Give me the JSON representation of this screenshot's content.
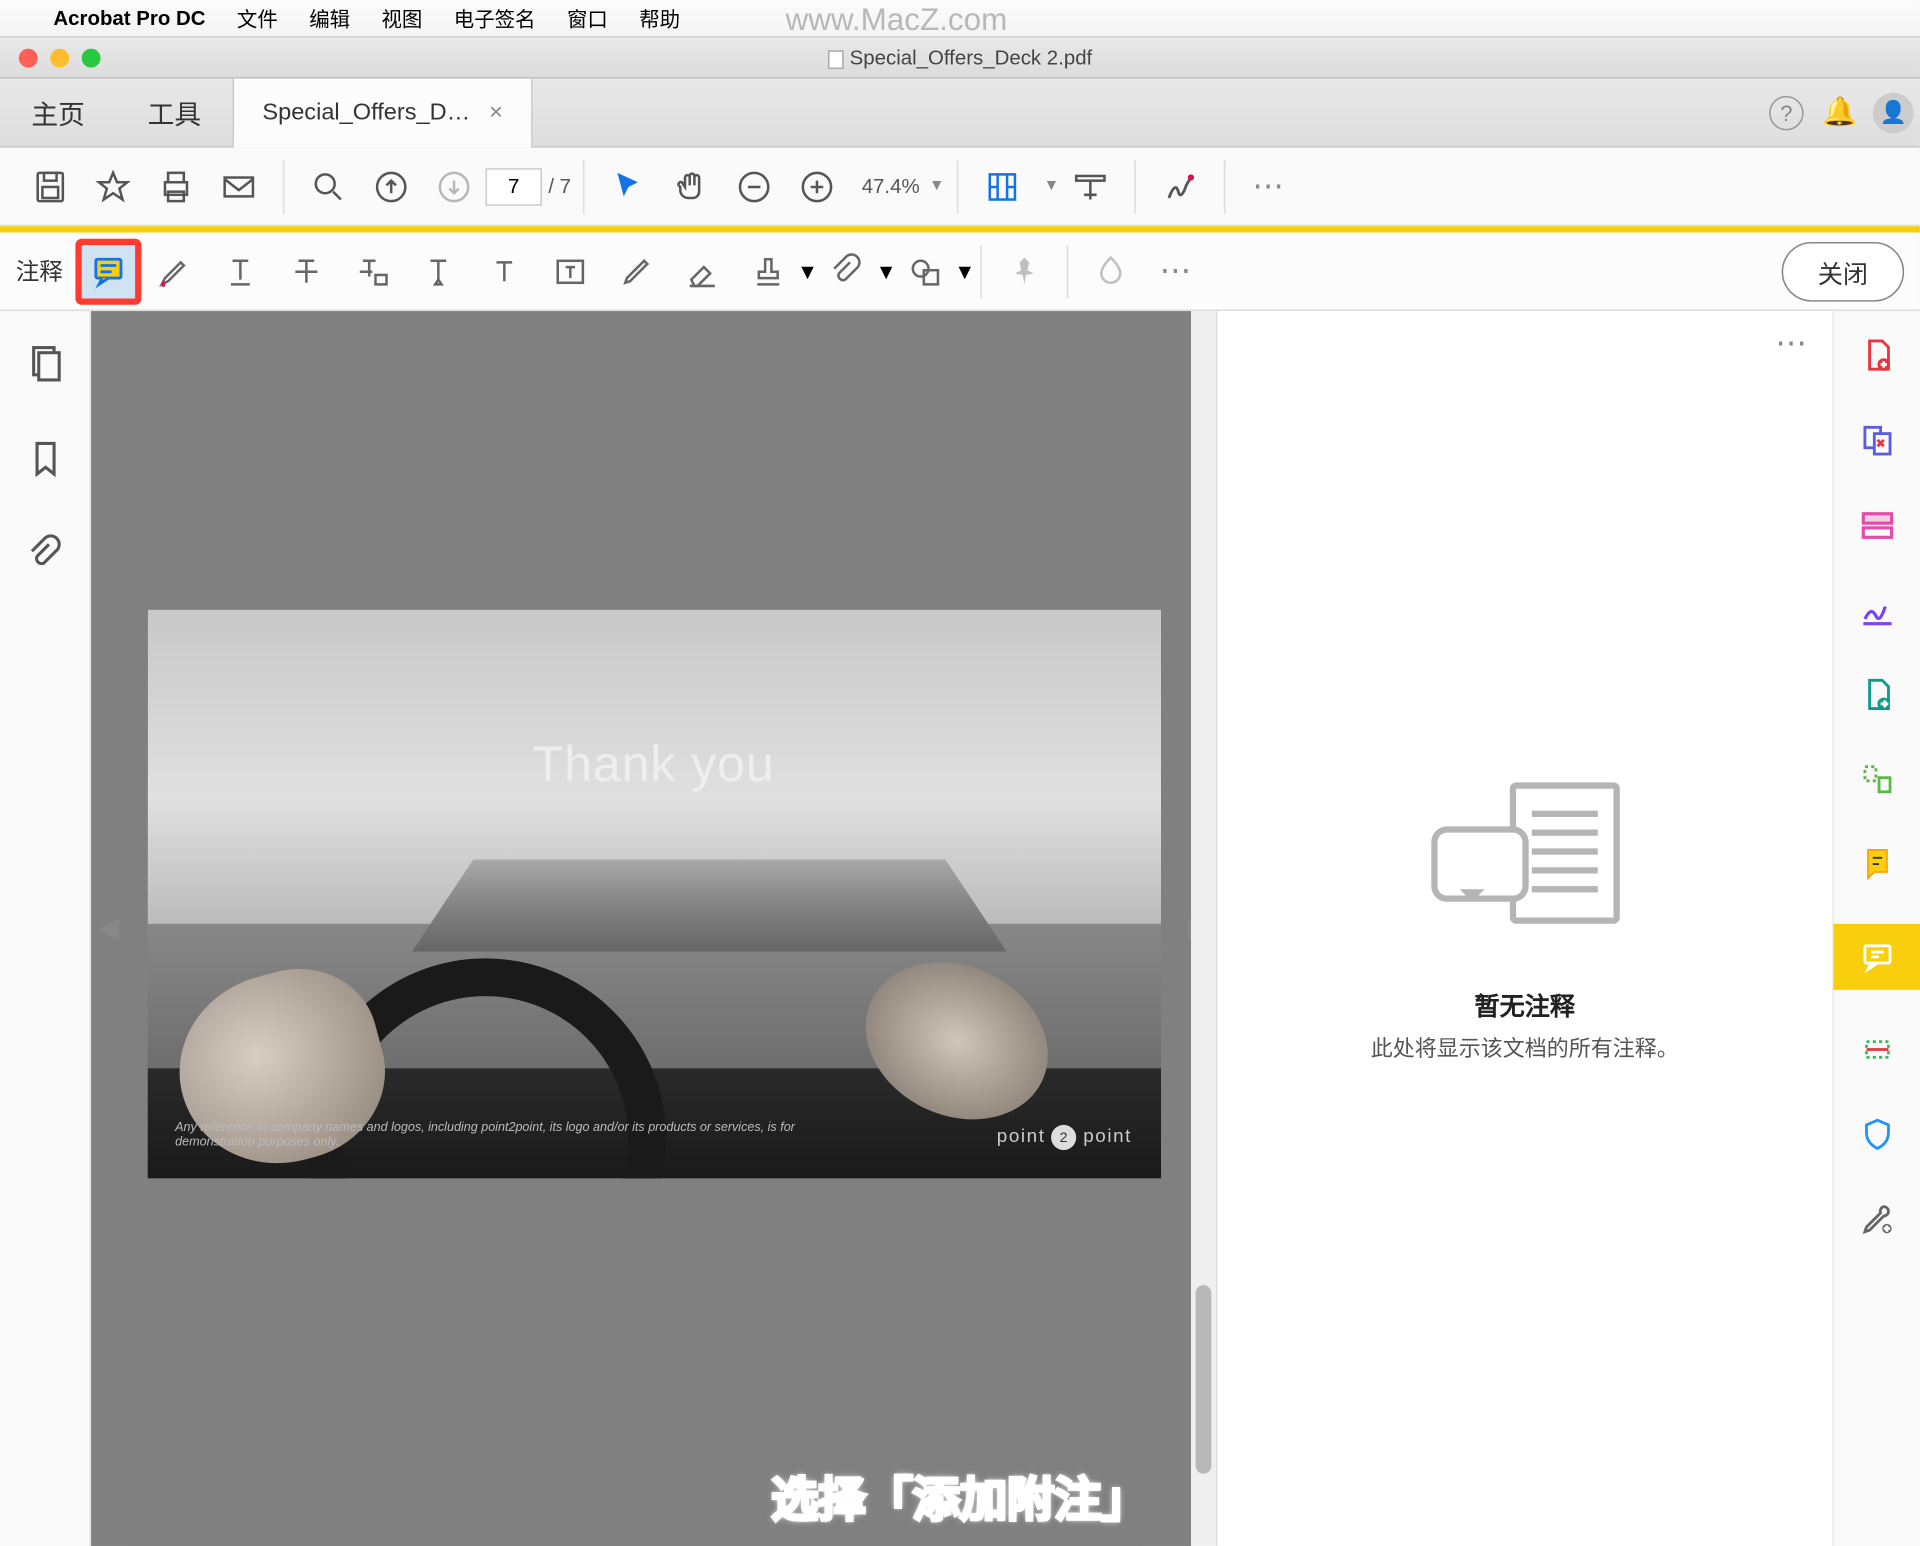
{
  "menubar": {
    "app": "Acrobat Pro DC",
    "items": [
      "文件",
      "编辑",
      "视图",
      "电子签名",
      "窗口",
      "帮助"
    ],
    "watermark": "www.MacZ.com"
  },
  "window": {
    "title": "Special_Offers_Deck 2.pdf"
  },
  "tabs": {
    "home": "主页",
    "tools": "工具",
    "active": "Special_Offers_D…",
    "close": "×"
  },
  "toolbar": {
    "page_current": "7",
    "page_total": "/ 7",
    "zoom": "47.4%",
    "more": "⋯"
  },
  "comment_bar": {
    "label": "注释",
    "close": "关闭",
    "more": "⋯"
  },
  "slide": {
    "title": "Thank you",
    "brand_left": "point",
    "brand_mid": "2",
    "brand_right": "point",
    "disclaimer": "Any reference to company names and logos, including point2point, its logo and/or its products or services, is for demonstration purposes only."
  },
  "comments_panel": {
    "menu": "⋯",
    "empty_title": "暂无注释",
    "empty_sub": "此处将显示该文档的所有注释。"
  },
  "caption": "选择「添加附注」"
}
